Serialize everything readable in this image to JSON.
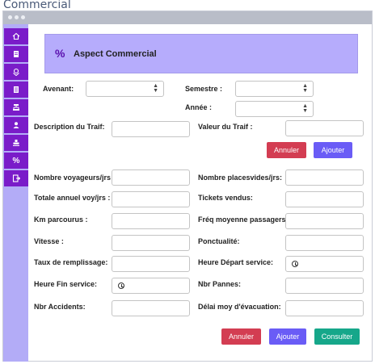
{
  "app": {
    "title": "Commercial"
  },
  "sidebar": {
    "items": [
      {
        "icon": "home-icon"
      },
      {
        "icon": "document-icon"
      },
      {
        "icon": "location-icon"
      },
      {
        "icon": "list-icon"
      },
      {
        "icon": "network-icon"
      },
      {
        "icon": "user-icon"
      },
      {
        "icon": "stamp-icon"
      },
      {
        "icon": "percent-icon",
        "glyph": "%"
      },
      {
        "icon": "export-icon"
      }
    ]
  },
  "banner": {
    "icon": "percent-icon",
    "glyph": "%",
    "title": "Aspect Commercial"
  },
  "filters": {
    "avenant_label": "Avenant:",
    "semestre_label": "Semestre :",
    "annee_label": "Année :"
  },
  "tarif": {
    "description_label": "Description du Traif:",
    "valeur_label": "Valeur du Traif :",
    "cancel_label": "Annuler",
    "add_label": "Ajouter"
  },
  "stats": {
    "nombre_voyageurs_label": "Nombre voyageurs/jrs :",
    "nombre_places_label": "Nombre placesvides/jrs:",
    "totale_annuel_label": "Totale annuel voy/jrs :",
    "tickets_label": "Tickets vendus:",
    "km_label": "Km parcourus :",
    "freq_label": "Fréq moyenne  passagers:",
    "vitesse_label": "Vitesse :",
    "ponctualite_label": "Ponctualité:",
    "taux_label": "Taux de remplissage:",
    "heure_depart_label": "Heure Départ service:",
    "heure_fin_label": "Heure Fin service:",
    "pannes_label": "Nbr Pannes:",
    "accidents_label": "Nbr Accidents:",
    "delai_label": "Délai moy d'évacuation:"
  },
  "footer": {
    "cancel_label": "Annuler",
    "add_label": "Ajouter",
    "consult_label": "Consulter"
  },
  "colors": {
    "sidebar_item": "#7a1cc9",
    "sidebar_bg": "#b3acf7",
    "banner_bg": "#b6acfc",
    "danger": "#d33d52",
    "primary": "#6a5cf6",
    "success": "#16a78a"
  }
}
